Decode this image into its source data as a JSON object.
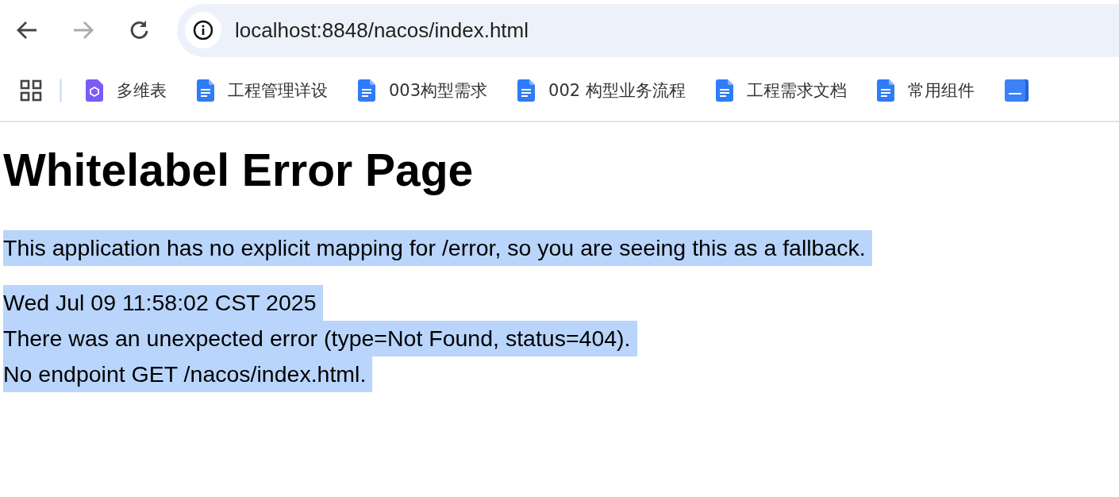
{
  "toolbar": {
    "back": {
      "disabled": false
    },
    "forward": {
      "disabled": true
    },
    "address": "localhost:8848/nacos/index.html"
  },
  "bookmarks": [
    {
      "kind": "sheet",
      "label": "多维表"
    },
    {
      "kind": "doc",
      "label": "工程管理详设"
    },
    {
      "kind": "doc",
      "label": "003构型需求"
    },
    {
      "kind": "doc",
      "label": "002 构型业务流程"
    },
    {
      "kind": "doc",
      "label": "工程需求文档"
    },
    {
      "kind": "doc",
      "label": "常用组件"
    },
    {
      "kind": "stack"
    }
  ],
  "page": {
    "title": "Whitelabel Error Page",
    "paragraphs": [
      {
        "lines": [
          {
            "text": "This application has no explicit mapping for /error, so you are seeing this as a fallback.",
            "highlighted": true
          }
        ]
      },
      {
        "lines": [
          {
            "text": "Wed Jul 09 11:58:02 CST 2025",
            "highlighted": true
          },
          {
            "text": "There was an unexpected error (type=Not Found, status=404).",
            "highlighted": true
          },
          {
            "text": "No endpoint GET /nacos/index.html.",
            "highlighted": true
          }
        ]
      }
    ]
  }
}
